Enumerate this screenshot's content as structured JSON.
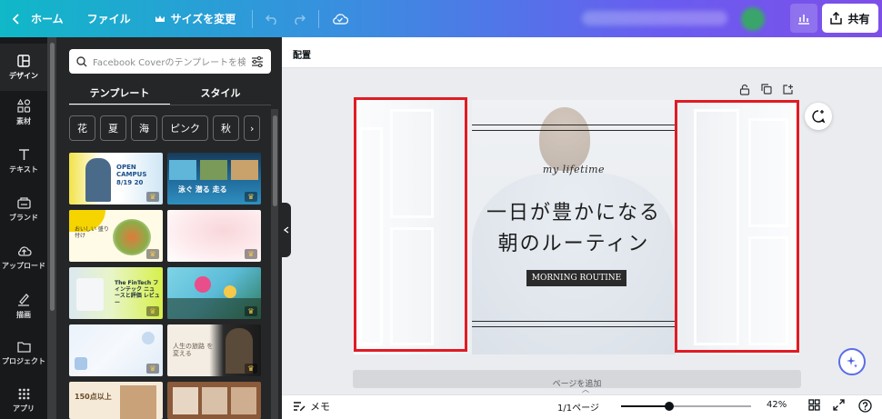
{
  "topbar": {
    "home_label": "ホーム",
    "file_label": "ファイル",
    "resize_label": "サイズを変更",
    "share_label": "共有"
  },
  "rail": {
    "items": [
      {
        "label": "デザイン",
        "icon": "layout-icon"
      },
      {
        "label": "素材",
        "icon": "elements-icon"
      },
      {
        "label": "テキスト",
        "icon": "text-icon"
      },
      {
        "label": "ブランド",
        "icon": "brand-icon"
      },
      {
        "label": "アップロード",
        "icon": "upload-icon"
      },
      {
        "label": "描画",
        "icon": "draw-icon"
      },
      {
        "label": "プロジェクト",
        "icon": "folder-icon"
      },
      {
        "label": "アプリ",
        "icon": "apps-icon"
      }
    ]
  },
  "panel": {
    "search_placeholder": "Facebook Coverのテンプレートを検",
    "tabs": [
      "テンプレート",
      "スタイル"
    ],
    "chips": [
      "花",
      "夏",
      "海",
      "ピンク",
      "秋",
      "›"
    ],
    "thumbs": [
      {
        "text": "OPEN CAMPUS 8/19 20"
      },
      {
        "text": "泳ぐ 潜る 走る"
      },
      {
        "text": "おいしい 盛り付け"
      },
      {
        "text": ""
      },
      {
        "text": "The FinTech フィンテック ニュースと評価 レビュー"
      },
      {
        "text": ""
      },
      {
        "text": ""
      },
      {
        "text": "人生の旅路 を変える"
      },
      {
        "text": "150点以上"
      },
      {
        "text": ""
      }
    ]
  },
  "workspace": {
    "header_title": "配置",
    "add_page_label": "ページを追加"
  },
  "canvas": {
    "script_text": "my lifetime",
    "title_line1": "一日が豊かになる",
    "title_line2": "朝のルーティン",
    "badge_text": "MORNING ROUTINE"
  },
  "bottombar": {
    "notes_label": "メモ",
    "page_label": "1/1ページ",
    "zoom_label": "42%",
    "zoom_value": 0.37
  },
  "colors": {
    "highlight": "#e01b24",
    "accent": "#7d4fe8"
  }
}
